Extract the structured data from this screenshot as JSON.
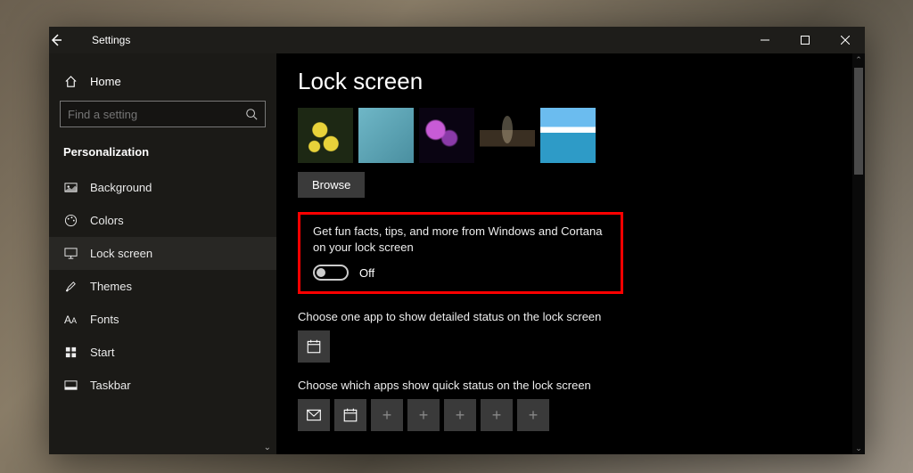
{
  "window": {
    "title": "Settings"
  },
  "sidebar": {
    "home": "Home",
    "search_placeholder": "Find a setting",
    "section": "Personalization",
    "items": [
      {
        "label": "Background",
        "icon": "picture-icon"
      },
      {
        "label": "Colors",
        "icon": "palette-icon"
      },
      {
        "label": "Lock screen",
        "icon": "monitor-icon",
        "active": true
      },
      {
        "label": "Themes",
        "icon": "paintbrush-icon"
      },
      {
        "label": "Fonts",
        "icon": "fonts-icon"
      },
      {
        "label": "Start",
        "icon": "start-icon"
      },
      {
        "label": "Taskbar",
        "icon": "taskbar-icon"
      }
    ]
  },
  "main": {
    "heading": "Lock screen",
    "browse_label": "Browse",
    "fun_facts": {
      "label": "Get fun facts, tips, and more from Windows and Cortana on your lock screen",
      "state": "Off",
      "value": false
    },
    "detailed_status": {
      "label": "Choose one app to show detailed status on the lock screen",
      "app_icon": "calendar-icon"
    },
    "quick_status": {
      "label": "Choose which apps show quick status on the lock screen",
      "apps": [
        {
          "icon": "mail-icon"
        },
        {
          "icon": "calendar-icon"
        },
        {
          "icon": "plus"
        },
        {
          "icon": "plus"
        },
        {
          "icon": "plus"
        },
        {
          "icon": "plus"
        },
        {
          "icon": "plus"
        }
      ]
    }
  }
}
